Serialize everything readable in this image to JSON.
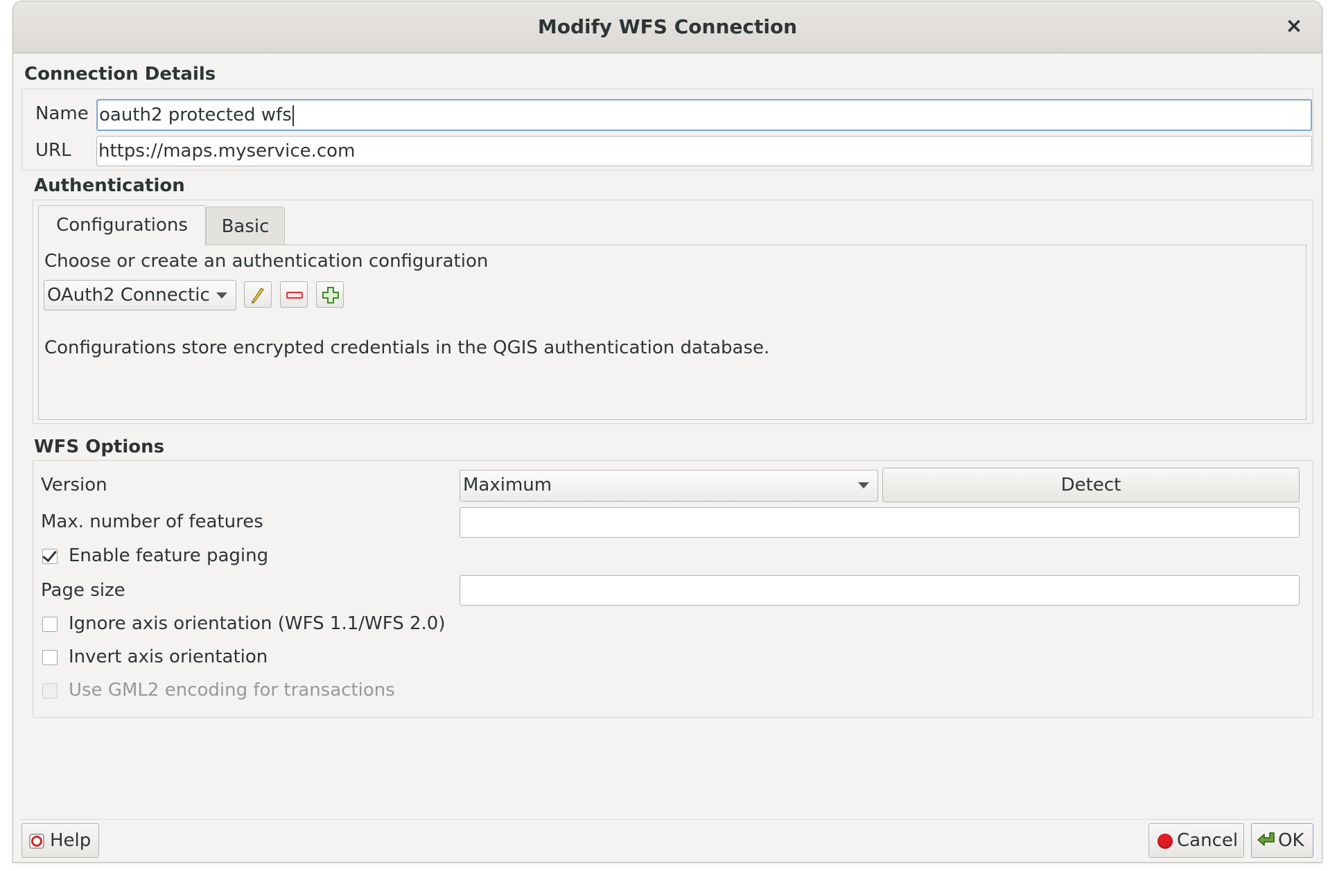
{
  "window": {
    "title": "Modify WFS Connection",
    "close_glyph": "×"
  },
  "connection_details": {
    "title": "Connection Details",
    "name_label": "Name",
    "name_value": "oauth2 protected wfs",
    "url_label": "URL",
    "url_value": "https://maps.myservice.com"
  },
  "authentication": {
    "title": "Authentication",
    "tabs": [
      {
        "label": "Configurations",
        "active": true
      },
      {
        "label": "Basic",
        "active": false
      }
    ],
    "prompt": "Choose or create an authentication configuration",
    "config_selected": "OAuth2 Connectic",
    "info": "Configurations store encrypted credentials in the QGIS authentication database.",
    "tool_icons": [
      "pencil-icon",
      "minus-icon",
      "plus-icon"
    ]
  },
  "wfs_options": {
    "title": "WFS Options",
    "version_label": "Version",
    "version_value": "Maximum",
    "detect_label": "Detect",
    "max_features_label": "Max. number of features",
    "max_features_value": "",
    "paging_label": "Enable feature paging",
    "paging_checked": true,
    "page_size_label": "Page size",
    "page_size_value": "",
    "ignore_axis_label": "Ignore axis orientation (WFS 1.1/WFS 2.0)",
    "ignore_axis_checked": false,
    "invert_axis_label": "Invert axis orientation",
    "invert_axis_checked": false,
    "gml2_label": "Use GML2 encoding for transactions",
    "gml2_checked": false,
    "gml2_enabled": false
  },
  "buttons": {
    "help": "Help",
    "cancel": "Cancel",
    "ok": "OK"
  },
  "colors": {
    "focus_border": "#7ea6da",
    "cancel_red": "#e01b24",
    "ok_green": "#4e7a27"
  }
}
